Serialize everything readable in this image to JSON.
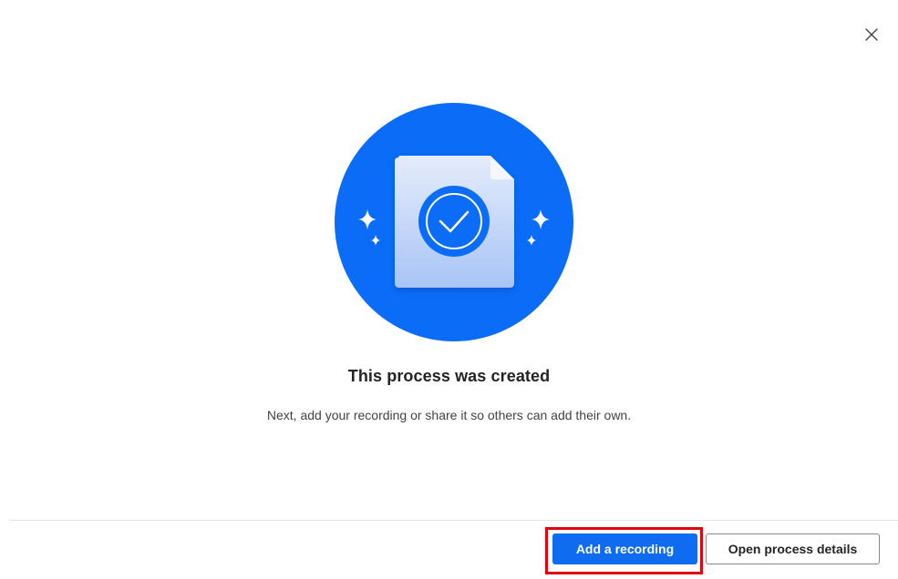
{
  "dialog": {
    "title": "This process was created",
    "subtitle": "Next, add your recording or share it so others can add their own.",
    "close_icon": "close-icon",
    "hero_icon": "document-check-icon"
  },
  "actions": {
    "primary_label": "Add a recording",
    "secondary_label": "Open process details"
  },
  "colors": {
    "accent": "#0f6cf0",
    "hero_circle": "#0a6cf7",
    "highlight": "#e3000f"
  }
}
